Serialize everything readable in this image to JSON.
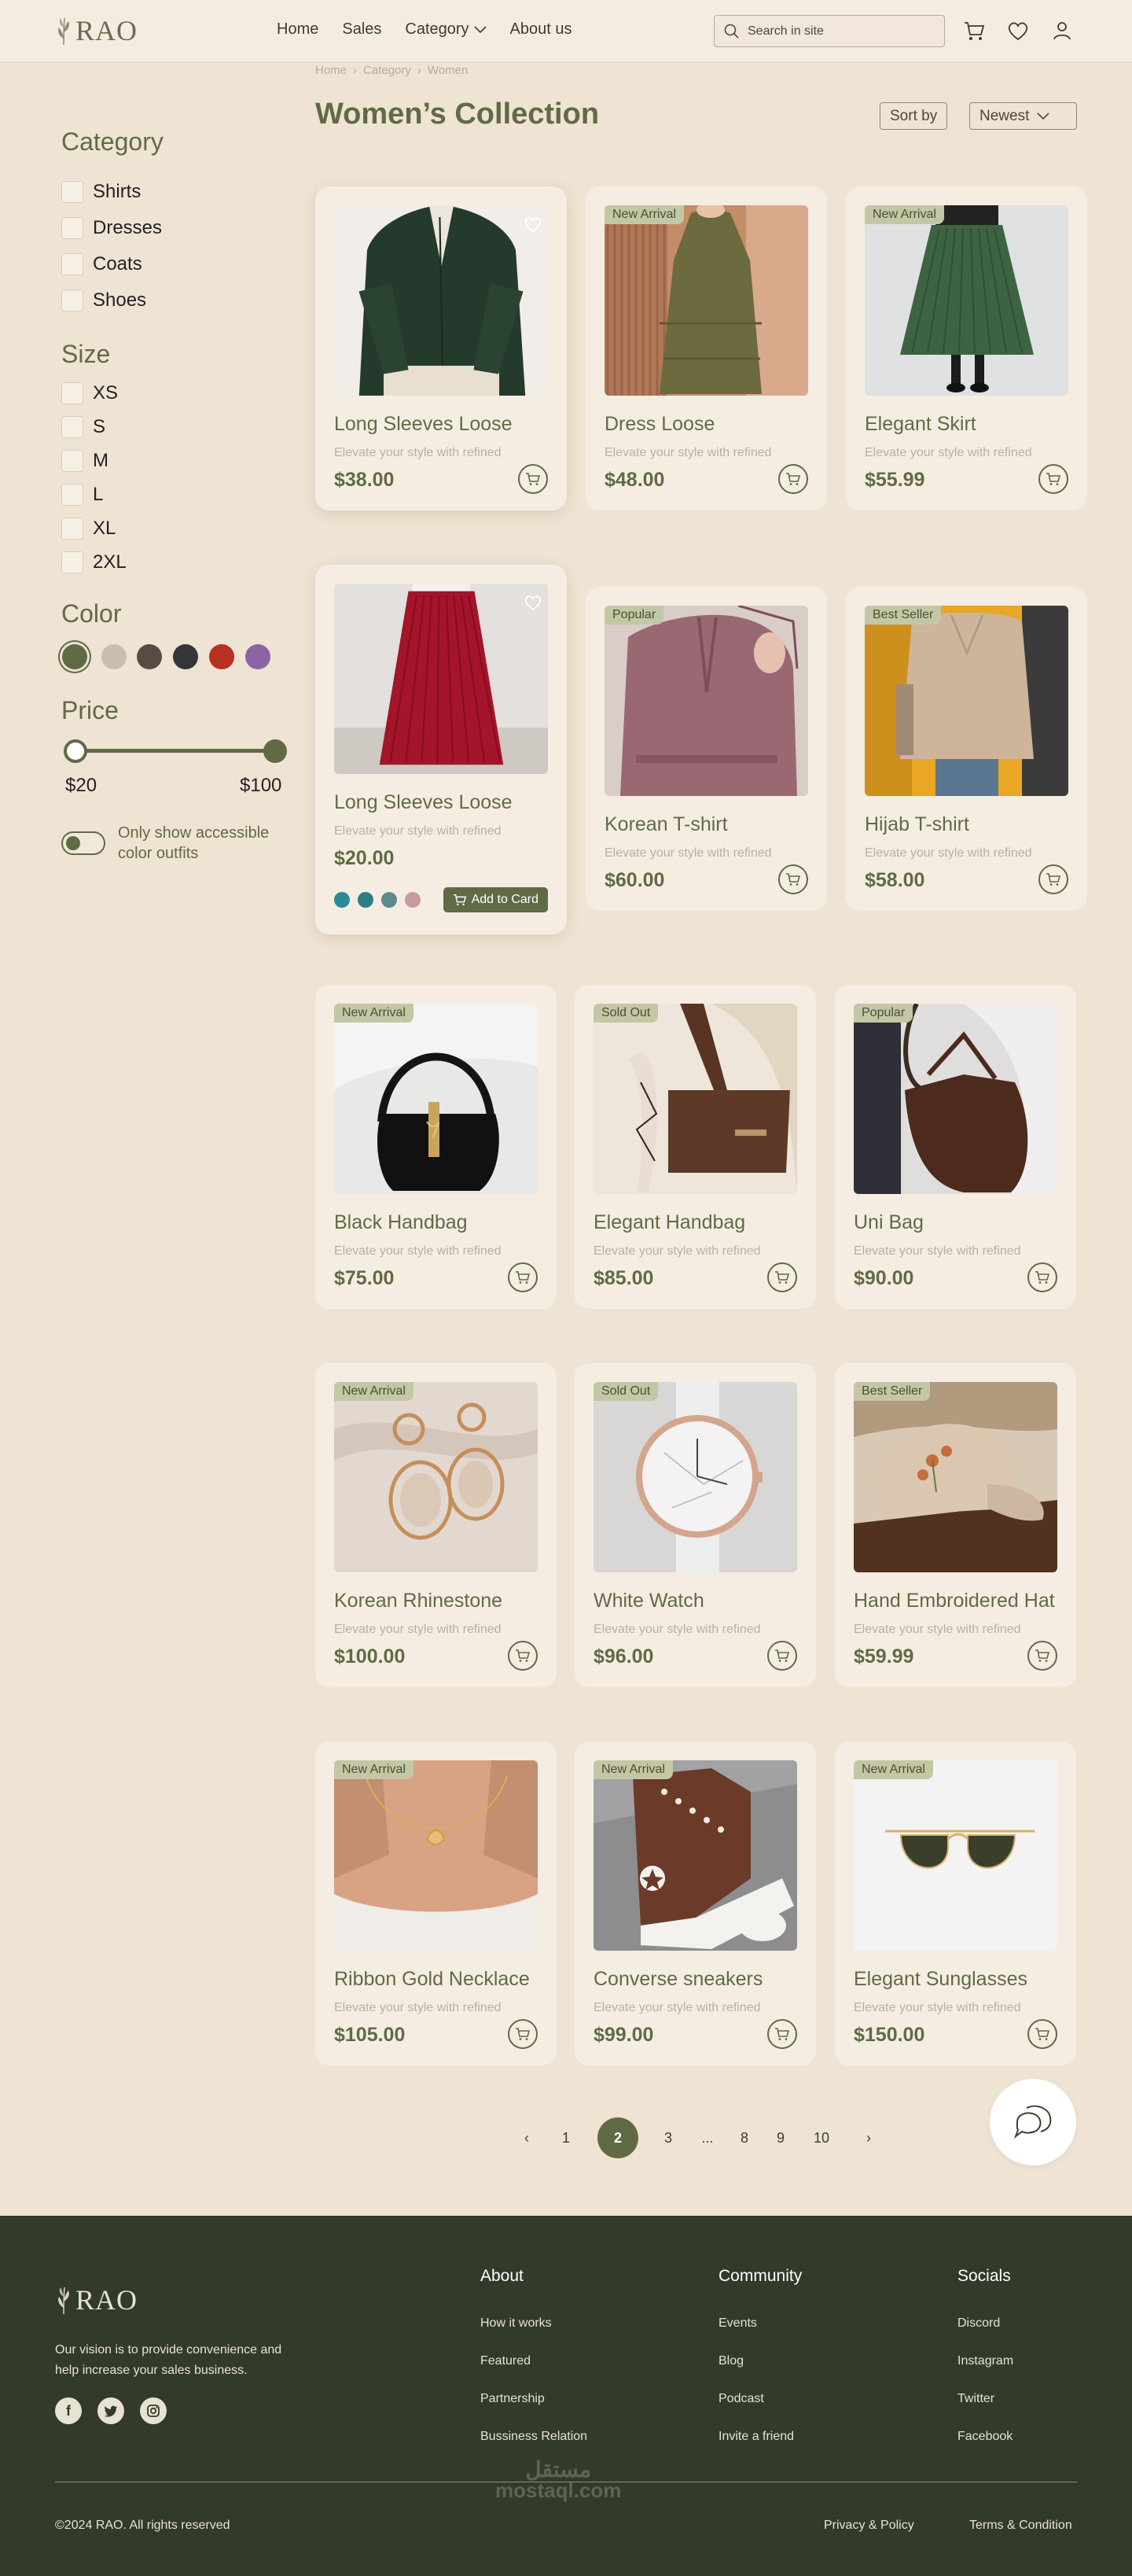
{
  "header": {
    "logo": "RAO",
    "nav": [
      "Home",
      "Sales",
      "Category",
      "About us"
    ],
    "search_placeholder": "Search in site"
  },
  "breadcrumb": [
    "Home",
    "Category",
    "Women"
  ],
  "page_title": "Women’s Collection",
  "sort": {
    "sort_label": "Sort by",
    "selected": "Newest"
  },
  "filters": {
    "category_title": "Category",
    "categories": [
      "Shirts",
      "Dresses",
      "Coats",
      "Shoes"
    ],
    "size_title": "Size",
    "sizes": [
      "XS",
      "S",
      "M",
      "L",
      "XL",
      "2XL"
    ],
    "color_title": "Color",
    "colors": [
      "#606b45",
      "#cbbcb1",
      "#5a4a44",
      "#34353b",
      "#b8301f",
      "#8b65a3"
    ],
    "price_title": "Price",
    "price_min": "$20",
    "price_max": "$100",
    "accessible_toggle": "Only show accessible color outfits"
  },
  "products": [
    {
      "name": "Long Sleeves Loose",
      "desc": "Elevate your style with refined",
      "price": "$38.00",
      "badge": "",
      "image": "green-blouse-photo"
    },
    {
      "name": "Dress Loose",
      "desc": "Elevate your style with refined",
      "price": "$48.00",
      "badge": "New Arrival",
      "image": "olive-dress-photo"
    },
    {
      "name": "Elegant Skirt",
      "desc": "Elevate your style with refined",
      "price": "$55.99",
      "badge": "New Arrival",
      "image": "green-skirt-photo"
    },
    {
      "name": "Long Sleeves Loose",
      "desc": "Elevate your style with refined",
      "price": "$20.00",
      "badge": "",
      "image": "red-skirt-photo"
    },
    {
      "name": "Korean T-shirt",
      "desc": "Elevate your style with refined",
      "price": "$60.00",
      "badge": "Popular",
      "image": "mauve-blouse-photo"
    },
    {
      "name": "Hijab T-shirt",
      "desc": "Elevate your style with refined",
      "price": "$58.00",
      "badge": "Best Seller",
      "image": "beige-sweater-photo"
    },
    {
      "name": "Black Handbag",
      "desc": "Elevate your style with refined",
      "price": "$75.00",
      "badge": "New Arrival",
      "image": "black-handbag-photo"
    },
    {
      "name": "Elegant Handbag",
      "desc": "Elevate your style with refined",
      "price": "$85.00",
      "badge": "Sold Out",
      "image": "brown-handbag-photo"
    },
    {
      "name": "Uni Bag",
      "desc": "Elevate your style with refined",
      "price": "$90.00",
      "badge": "Popular",
      "image": "leather-bag-photo"
    },
    {
      "name": "Korean Rhinestone",
      "desc": "Elevate your style with refined",
      "price": "$100.00",
      "badge": "New Arrival",
      "image": "earrings-photo"
    },
    {
      "name": "White Watch",
      "desc": "Elevate your style with refined",
      "price": "$96.00",
      "badge": "Sold Out",
      "image": "watch-photo"
    },
    {
      "name": "Hand Embroidered Hat",
      "desc": "Elevate your style with refined",
      "price": "$59.99",
      "badge": "Best Seller",
      "image": "cap-photo"
    },
    {
      "name": "Ribbon Gold Necklace",
      "desc": "Elevate your style with refined",
      "price": "$105.00",
      "badge": "New Arrival",
      "image": "necklace-photo"
    },
    {
      "name": "Converse sneakers",
      "desc": "Elevate your style with refined",
      "price": "$99.00",
      "badge": "New Arrival",
      "image": "sneaker-photo"
    },
    {
      "name": "Elegant Sunglasses",
      "desc": "Elevate your style with refined",
      "price": "$150.00",
      "badge": "New Arrival",
      "image": "sunglasses-photo"
    }
  ],
  "featured_colors": [
    "#2a8a9a",
    "#2d7f86",
    "#5d8a8f",
    "#c79aa0"
  ],
  "add_to_card": "Add to Card",
  "pagination": [
    "1",
    "2",
    "3",
    "...",
    "8",
    "9",
    "10"
  ],
  "pagination_active": "2",
  "footer": {
    "logo": "RAO",
    "vision": "Our vision is to provide convenience and help increase your sales business.",
    "columns": [
      {
        "title": "About",
        "links": [
          "How it works",
          "Featured",
          "Partnership",
          "Bussiness Relation"
        ]
      },
      {
        "title": "Community",
        "links": [
          "Events",
          "Blog",
          "Podcast",
          "Invite a friend"
        ]
      },
      {
        "title": "Socials",
        "links": [
          "Discord",
          "Instagram",
          "Twitter",
          "Facebook"
        ]
      }
    ],
    "copyright": "©2024 RAO. All rights reserved",
    "privacy": "Privacy & Policy",
    "terms": "Terms & Condition",
    "watermark_ar": "مستقل",
    "watermark": "mostaql.com"
  }
}
